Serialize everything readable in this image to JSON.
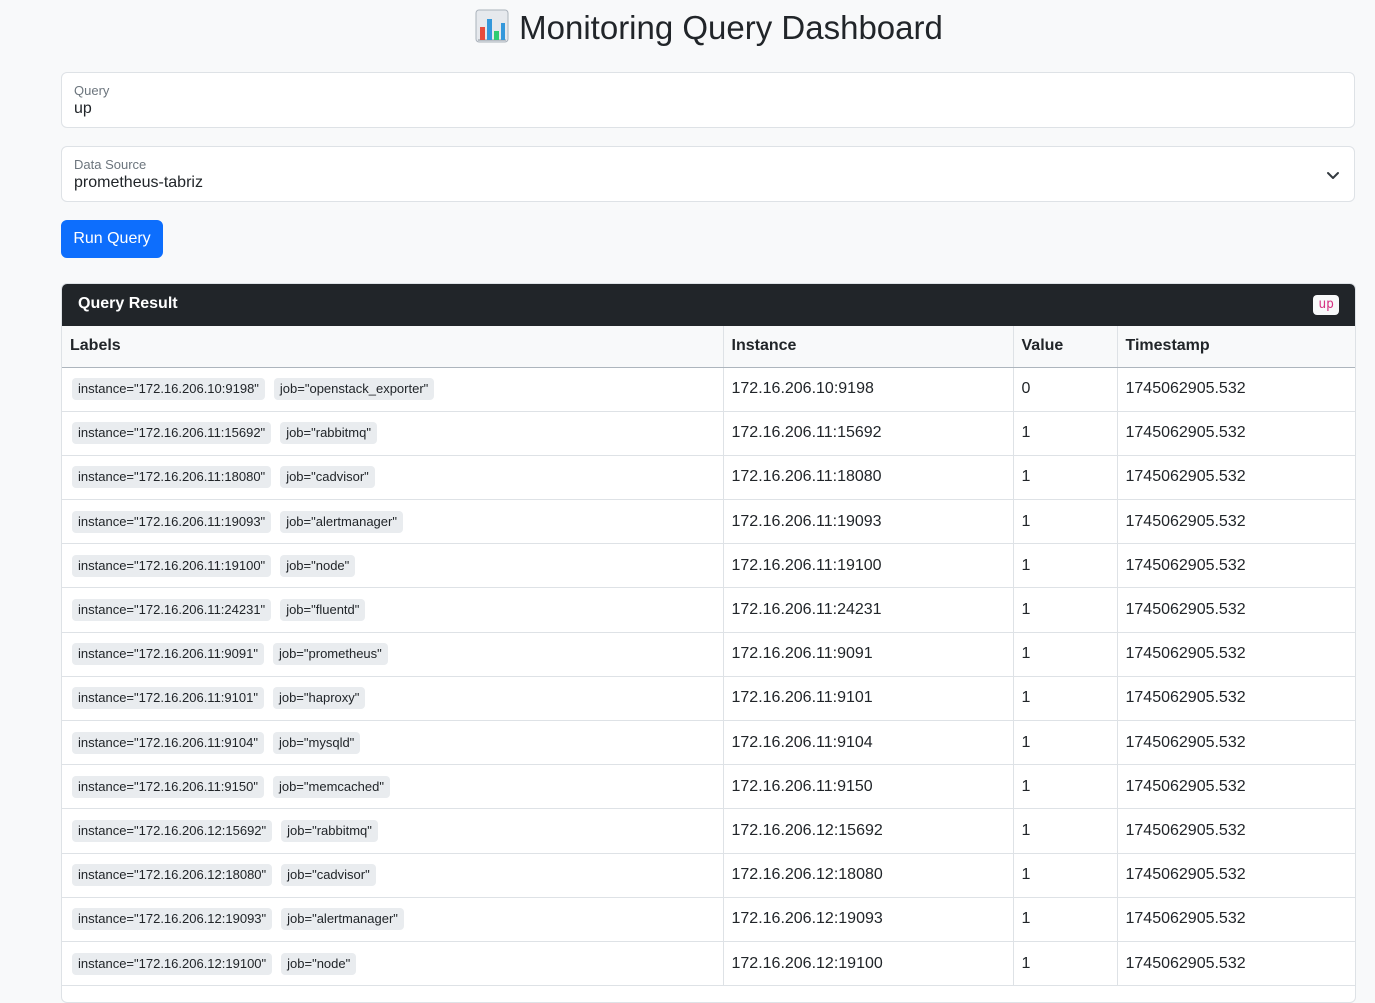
{
  "header": {
    "title": "Monitoring Query Dashboard",
    "icon": "bar-chart-icon"
  },
  "query_field": {
    "label": "Query",
    "value": "up"
  },
  "source_field": {
    "label": "Data Source",
    "value": "prometheus-tabriz"
  },
  "run_button": {
    "label": "Run Query"
  },
  "result": {
    "title": "Query Result",
    "badge": "up",
    "columns": [
      "Labels",
      "Instance",
      "Value",
      "Timestamp"
    ],
    "rows": [
      {
        "labels": [
          "instance=\"172.16.206.10:9198\"",
          "job=\"openstack_exporter\""
        ],
        "instance": "172.16.206.10:9198",
        "value": "0",
        "timestamp": "1745062905.532"
      },
      {
        "labels": [
          "instance=\"172.16.206.11:15692\"",
          "job=\"rabbitmq\""
        ],
        "instance": "172.16.206.11:15692",
        "value": "1",
        "timestamp": "1745062905.532"
      },
      {
        "labels": [
          "instance=\"172.16.206.11:18080\"",
          "job=\"cadvisor\""
        ],
        "instance": "172.16.206.11:18080",
        "value": "1",
        "timestamp": "1745062905.532"
      },
      {
        "labels": [
          "instance=\"172.16.206.11:19093\"",
          "job=\"alertmanager\""
        ],
        "instance": "172.16.206.11:19093",
        "value": "1",
        "timestamp": "1745062905.532"
      },
      {
        "labels": [
          "instance=\"172.16.206.11:19100\"",
          "job=\"node\""
        ],
        "instance": "172.16.206.11:19100",
        "value": "1",
        "timestamp": "1745062905.532"
      },
      {
        "labels": [
          "instance=\"172.16.206.11:24231\"",
          "job=\"fluentd\""
        ],
        "instance": "172.16.206.11:24231",
        "value": "1",
        "timestamp": "1745062905.532"
      },
      {
        "labels": [
          "instance=\"172.16.206.11:9091\"",
          "job=\"prometheus\""
        ],
        "instance": "172.16.206.11:9091",
        "value": "1",
        "timestamp": "1745062905.532"
      },
      {
        "labels": [
          "instance=\"172.16.206.11:9101\"",
          "job=\"haproxy\""
        ],
        "instance": "172.16.206.11:9101",
        "value": "1",
        "timestamp": "1745062905.532"
      },
      {
        "labels": [
          "instance=\"172.16.206.11:9104\"",
          "job=\"mysqld\""
        ],
        "instance": "172.16.206.11:9104",
        "value": "1",
        "timestamp": "1745062905.532"
      },
      {
        "labels": [
          "instance=\"172.16.206.11:9150\"",
          "job=\"memcached\""
        ],
        "instance": "172.16.206.11:9150",
        "value": "1",
        "timestamp": "1745062905.532"
      },
      {
        "labels": [
          "instance=\"172.16.206.12:15692\"",
          "job=\"rabbitmq\""
        ],
        "instance": "172.16.206.12:15692",
        "value": "1",
        "timestamp": "1745062905.532"
      },
      {
        "labels": [
          "instance=\"172.16.206.12:18080\"",
          "job=\"cadvisor\""
        ],
        "instance": "172.16.206.12:18080",
        "value": "1",
        "timestamp": "1745062905.532"
      },
      {
        "labels": [
          "instance=\"172.16.206.12:19093\"",
          "job=\"alertmanager\""
        ],
        "instance": "172.16.206.12:19093",
        "value": "1",
        "timestamp": "1745062905.532"
      },
      {
        "labels": [
          "instance=\"172.16.206.12:19100\"",
          "job=\"node\""
        ],
        "instance": "172.16.206.12:19100",
        "value": "1",
        "timestamp": "1745062905.532"
      }
    ]
  },
  "colors": {
    "primary": "#0d6efd",
    "card_header": "#212529",
    "badge_text": "#d63384"
  }
}
